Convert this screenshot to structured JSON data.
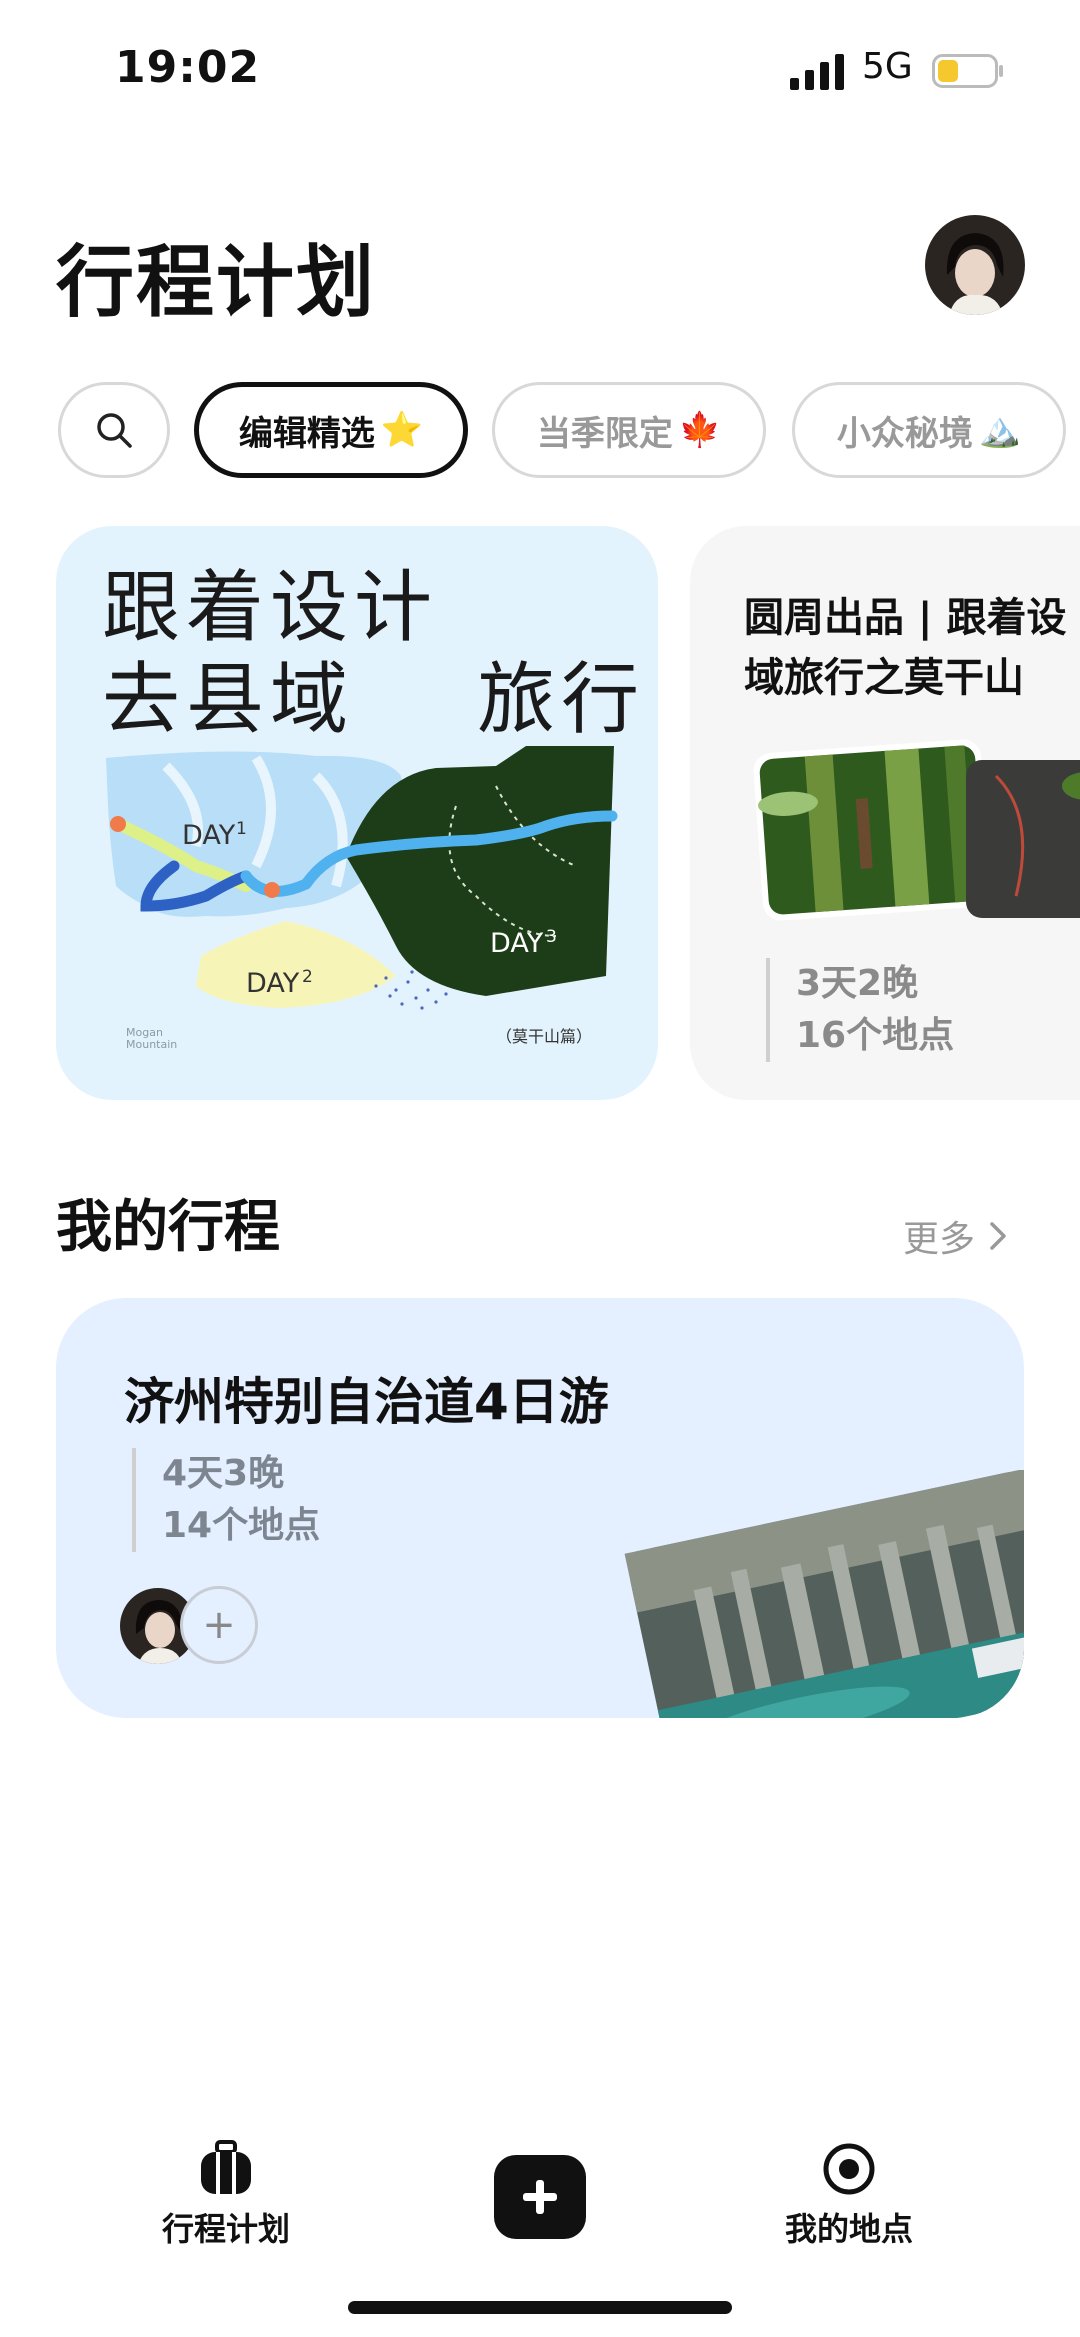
{
  "status_bar": {
    "time": "19:02",
    "network": "5G",
    "battery_level": 0.3
  },
  "header": {
    "title": "行程计划"
  },
  "chips": {
    "items": [
      {
        "label": "编辑精选",
        "emoji": "⭐"
      },
      {
        "label": "当季限定",
        "emoji": "🍁"
      },
      {
        "label": "小众秘境",
        "emoji": "🏔️"
      }
    ],
    "selected": "编辑精选"
  },
  "featured": {
    "card1": {
      "title_line1": "跟着设计",
      "title_line2": "去县域    旅行",
      "map_labels": {
        "day1": "DAY",
        "day1_n": "1",
        "day2": "DAY",
        "day2_n": "2",
        "day3": "DAY",
        "day3_n": "3",
        "region1": "Mogan",
        "region2": "Mountain",
        "caption": "（莫干山篇）"
      }
    },
    "card2": {
      "title_line1": "圆周出品 | 跟着设",
      "title_line2": "域旅行之莫干山",
      "duration": "3天2晚",
      "places": "16个地点"
    }
  },
  "my_trips": {
    "section_title": "我的行程",
    "more_label": "更多",
    "trip": {
      "title": "济州特别自治道4日游",
      "duration": "4天3晚",
      "places": "14个地点",
      "add_symbol": "+"
    }
  },
  "bottom_nav": {
    "plan_label": "行程计划",
    "places_label": "我的地点"
  },
  "colors": {
    "accent": "#111111",
    "card1_bg": "#e3f3fd",
    "trip_bg": "#e4efff",
    "battery": "#f5c82e"
  }
}
